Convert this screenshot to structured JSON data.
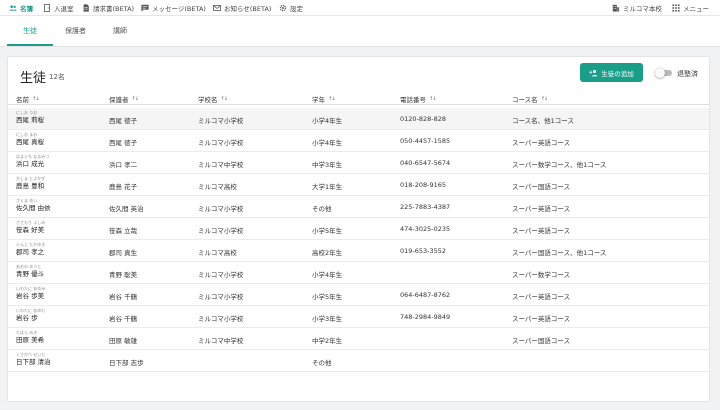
{
  "nav": {
    "items": [
      {
        "label": "名簿",
        "icon": "people-icon",
        "active": true
      },
      {
        "label": "入退室",
        "icon": "door-icon",
        "active": false
      },
      {
        "label": "請求書(BETA)",
        "icon": "invoice-icon",
        "active": false
      },
      {
        "label": "メッセージ(BETA)",
        "icon": "message-icon",
        "active": false
      },
      {
        "label": "お知らせ(BETA)",
        "icon": "mail-icon",
        "active": false
      },
      {
        "label": "設定",
        "icon": "gear-icon",
        "active": false
      }
    ],
    "school": "ミルコマ本校",
    "menu": "メニュー"
  },
  "tabs": [
    {
      "label": "生徒",
      "active": true
    },
    {
      "label": "保護者",
      "active": false
    },
    {
      "label": "講師",
      "active": false
    }
  ],
  "header": {
    "title": "生徒",
    "count": "12名",
    "add_button": "生徒の追加",
    "toggle_label": "退塾済"
  },
  "columns": [
    "名前",
    "保護者",
    "学校名",
    "学年",
    "電話番号",
    "コース名"
  ],
  "rows": [
    {
      "kana": "にしお りお",
      "name": "西尾 莉桜",
      "guardian": "西尾 徳子",
      "school": "ミルコマ小学校",
      "grade": "小学4年生",
      "phone": "0120-828-828",
      "course": "コース名、他1コース"
    },
    {
      "kana": "にしお まお",
      "name": "西尾 真桜",
      "guardian": "西尾 徳子",
      "school": "ミルコマ小学校",
      "grade": "小学4年生",
      "phone": "050-4457-1585",
      "course": "スーパー英語コース"
    },
    {
      "kana": "はまぐち なるみつ",
      "name": "浜口 成光",
      "guardian": "浜口 孝二",
      "school": "ミルコマ中学校",
      "grade": "中学3年生",
      "phone": "040-6547-5674",
      "course": "スーパー数学コース、他1コース"
    },
    {
      "kana": "かしま とよかず",
      "name": "鹿島 豊和",
      "guardian": "鹿島 花子",
      "school": "ミルコマ高校",
      "grade": "大学1年生",
      "phone": "018-208-9165",
      "course": "スーパー国語コース"
    },
    {
      "kana": "さくま ゆい",
      "name": "佐久間 由依",
      "guardian": "佐久間 英治",
      "school": "ミルコマ小学校",
      "grade": "その他",
      "phone": "225-7883-4387",
      "course": "スーパー英語コース"
    },
    {
      "kana": "ささもり よしみ",
      "name": "笹森 好美",
      "guardian": "笹森 立哉",
      "school": "ミルコマ小学校",
      "grade": "小学5年生",
      "phone": "474-3025-0235",
      "course": "スーパー英語コース"
    },
    {
      "kana": "ぐんじ たかゆき",
      "name": "郡司 孝之",
      "guardian": "郡司 真生",
      "school": "ミルコマ高校",
      "grade": "高校2年生",
      "phone": "019-653-3552",
      "course": "スーパー国語コース、他1コース"
    },
    {
      "kana": "あおの ゆうと",
      "name": "青野 優斗",
      "guardian": "青野 聡美",
      "school": "ミルコマ小学校",
      "grade": "小学4年生",
      "phone": "",
      "course": "スーパー数学コース"
    },
    {
      "kana": "いわたに あゆみ",
      "name": "岩谷 歩美",
      "guardian": "岩谷 千鶴",
      "school": "ミルコマ小学校",
      "grade": "小学5年生",
      "phone": "064-6487-8762",
      "course": "スーパー英語コース"
    },
    {
      "kana": "いわたに あゆむ",
      "name": "岩谷 歩",
      "guardian": "岩谷 千鶴",
      "school": "ミルコマ小学校",
      "grade": "小学3年生",
      "phone": "748-2984-9849",
      "course": "スーパー英語コース"
    },
    {
      "kana": "たはら みき",
      "name": "田原 美希",
      "guardian": "田原 敏雄",
      "school": "ミルコマ中学校",
      "grade": "中学2年生",
      "phone": "",
      "course": "スーパー国語コース"
    },
    {
      "kana": "くさかべ せいじ",
      "name": "日下部 清治",
      "guardian": "日下部 志歩",
      "school": "",
      "grade": "その他",
      "phone": "",
      "course": ""
    }
  ],
  "colors": {
    "accent": "#1a9e8a",
    "row_highlight": "#f5f5f5"
  }
}
